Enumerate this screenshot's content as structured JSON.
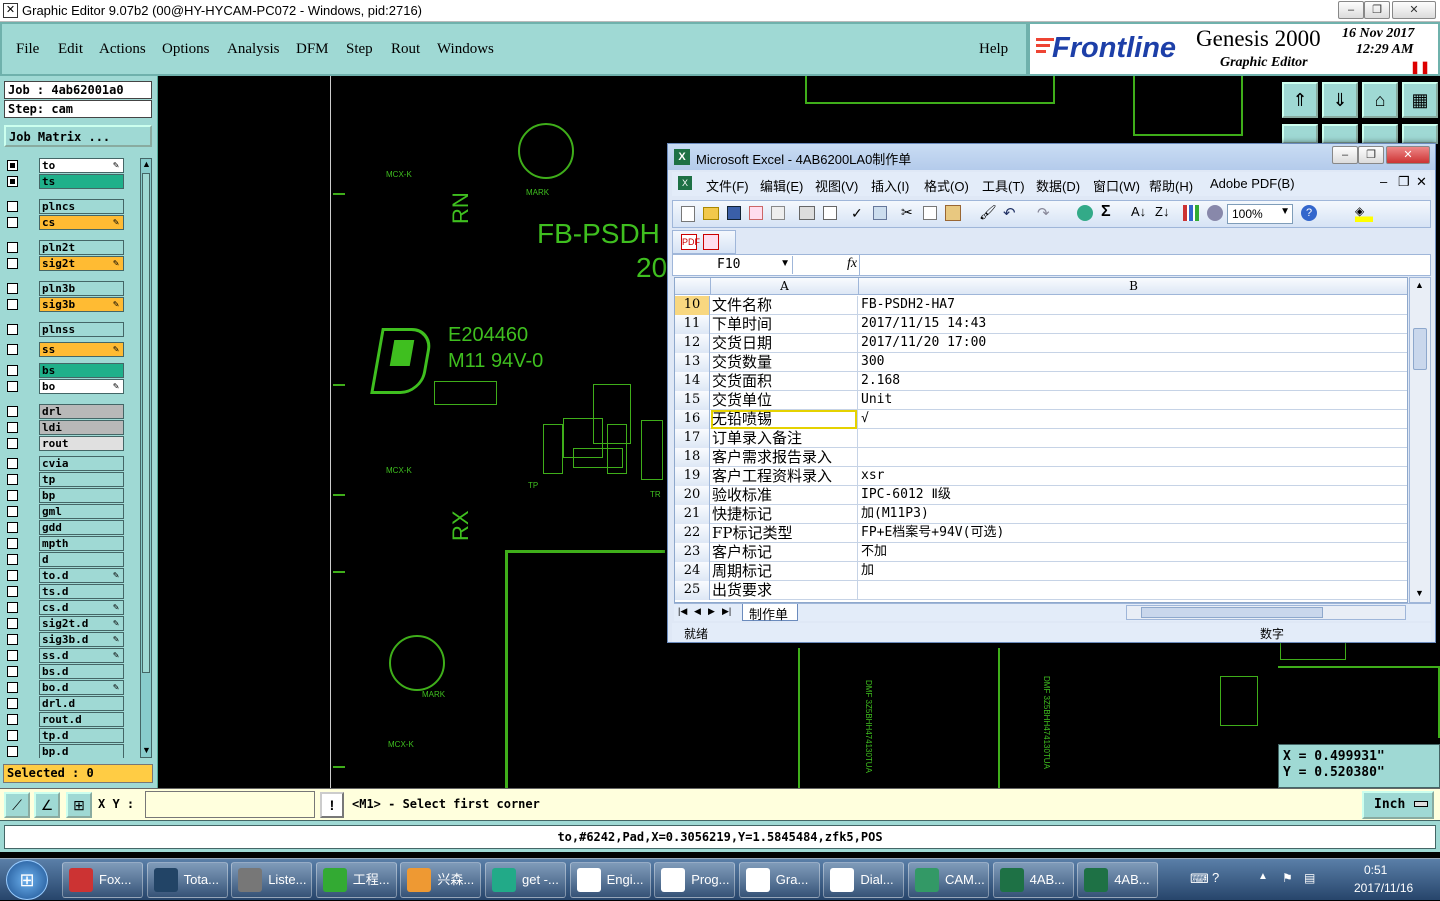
{
  "genesis": {
    "title": "Graphic Editor 9.07b2 (00@HY-HYCAM-PC072 - Windows, pid:2716)",
    "menu": [
      "File",
      "Edit",
      "Actions",
      "Options",
      "Analysis",
      "DFM",
      "Step",
      "Rout",
      "Windows"
    ],
    "help": "Help",
    "brand": "Frontline",
    "product": "Genesis 2000",
    "product_sub": "Graphic Editor",
    "date": "16 Nov 2017",
    "time": "12:29 AM",
    "job": "Job : 4ab62001a0",
    "step": "Step: cam",
    "job_matrix": "Job Matrix ...",
    "layers": [
      {
        "name": "to",
        "color": "#ffffff",
        "checked": true,
        "edit": true
      },
      {
        "name": "ts",
        "color": "#1fb08a",
        "checked": true,
        "edit": false
      },
      {
        "name": "plncs",
        "color": "#9fd9d4",
        "checked": false,
        "edit": false
      },
      {
        "name": "cs",
        "color": "#ffbb33",
        "checked": false,
        "edit": true
      },
      {
        "name": "pln2t",
        "color": "#9fd9d4",
        "checked": false,
        "edit": false
      },
      {
        "name": "sig2t",
        "color": "#ffbb33",
        "checked": false,
        "edit": true
      },
      {
        "name": "pln3b",
        "color": "#9fd9d4",
        "checked": false,
        "edit": false
      },
      {
        "name": "sig3b",
        "color": "#ffbb33",
        "checked": false,
        "edit": true
      },
      {
        "name": "plnss",
        "color": "#9fd9d4",
        "checked": false,
        "edit": false
      },
      {
        "name": "ss",
        "color": "#ffbb33",
        "checked": false,
        "edit": true
      },
      {
        "name": "bs",
        "color": "#1fb08a",
        "checked": false,
        "edit": false
      },
      {
        "name": "bo",
        "color": "#ffffff",
        "checked": false,
        "edit": true
      },
      {
        "name": "drl",
        "color": "#b8b8b8",
        "checked": false,
        "edit": false
      },
      {
        "name": "ldi",
        "color": "#b8b8b8",
        "checked": false,
        "edit": false
      },
      {
        "name": "rout",
        "color": "#e0e0e0",
        "checked": false,
        "edit": false
      },
      {
        "name": "cvia",
        "color": "#9fd9d4",
        "checked": false,
        "edit": false
      },
      {
        "name": "tp",
        "color": "#9fd9d4",
        "checked": false,
        "edit": false
      },
      {
        "name": "bp",
        "color": "#9fd9d4",
        "checked": false,
        "edit": false
      },
      {
        "name": "gml",
        "color": "#9fd9d4",
        "checked": false,
        "edit": false
      },
      {
        "name": "gdd",
        "color": "#9fd9d4",
        "checked": false,
        "edit": false
      },
      {
        "name": "mpth",
        "color": "#9fd9d4",
        "checked": false,
        "edit": false
      },
      {
        "name": "d",
        "color": "#9fd9d4",
        "checked": false,
        "edit": false
      },
      {
        "name": "to.d",
        "color": "#9fd9d4",
        "checked": false,
        "edit": true
      },
      {
        "name": "ts.d",
        "color": "#9fd9d4",
        "checked": false,
        "edit": false
      },
      {
        "name": "cs.d",
        "color": "#9fd9d4",
        "checked": false,
        "edit": true
      },
      {
        "name": "sig2t.d",
        "color": "#9fd9d4",
        "checked": false,
        "edit": true
      },
      {
        "name": "sig3b.d",
        "color": "#9fd9d4",
        "checked": false,
        "edit": true
      },
      {
        "name": "ss.d",
        "color": "#9fd9d4",
        "checked": false,
        "edit": true
      },
      {
        "name": "bs.d",
        "color": "#9fd9d4",
        "checked": false,
        "edit": false
      },
      {
        "name": "bo.d",
        "color": "#9fd9d4",
        "checked": false,
        "edit": true
      },
      {
        "name": "drl.d",
        "color": "#9fd9d4",
        "checked": false,
        "edit": false
      },
      {
        "name": "rout.d",
        "color": "#9fd9d4",
        "checked": false,
        "edit": false
      },
      {
        "name": "tp.d",
        "color": "#9fd9d4",
        "checked": false,
        "edit": false
      },
      {
        "name": "bp.d",
        "color": "#9fd9d4",
        "checked": false,
        "edit": false
      }
    ],
    "selected": "Selected : 0",
    "xy_label": "X Y :",
    "xy_value": "",
    "prompt": "<M1> - Select first corner",
    "units": "Inch",
    "status": "to,#6242,Pad,X=0.3056219,Y=1.5845484,zfk5,POS",
    "coord_x": "X = 0.499931\"",
    "coord_y": "Y = 0.520380\"",
    "canvas_text": {
      "fb": "FB-PSDH",
      "fb2": "20",
      "ul": "E204460",
      "ul2": "M11 94V-0",
      "rn": "RN",
      "rx": "RX",
      "mark": "MARK",
      "mcx": "MCX-K",
      "tp": "TP",
      "tr": "TR",
      "dmf1": "DMF 3Z5BHH474130TUA",
      "dmf2": "DMF 3Z5BHH474130TUA"
    }
  },
  "excel": {
    "title": "Microsoft Excel - 4AB6200LA0制作单",
    "menu": [
      "文件(F)",
      "编辑(E)",
      "视图(V)",
      "插入(I)",
      "格式(O)",
      "工具(T)",
      "数据(D)",
      "窗口(W)",
      "帮助(H)",
      "Adobe PDF(B)"
    ],
    "namebox": "F10",
    "zoom": "100%",
    "col_a": "A",
    "col_b": "B",
    "rows": [
      {
        "n": "10",
        "a": "文件名称",
        "b": "FB-PSDH2-HA7"
      },
      {
        "n": "11",
        "a": "下单时间",
        "b": "2017/11/15 14:43"
      },
      {
        "n": "12",
        "a": "交货日期",
        "b": "2017/11/20 17:00"
      },
      {
        "n": "13",
        "a": "交货数量",
        "b": "300"
      },
      {
        "n": "14",
        "a": "交货面积",
        "b": "2.168"
      },
      {
        "n": "15",
        "a": "交货单位",
        "b": "Unit"
      },
      {
        "n": "16",
        "a": "无铅喷锡",
        "b": "√"
      },
      {
        "n": "17",
        "a": "订单录入备注",
        "b": ""
      },
      {
        "n": "18",
        "a": "客户需求报告录入",
        "b": ""
      },
      {
        "n": "19",
        "a": "客户工程资料录入",
        "b": "xsr"
      },
      {
        "n": "20",
        "a": "验收标准",
        "b": "IPC-6012 Ⅱ级"
      },
      {
        "n": "21",
        "a": "快捷标记",
        "b": "加(M11P3)"
      },
      {
        "n": "22",
        "a": "FP标记类型",
        "b": "FP+E档案号+94V(可选)"
      },
      {
        "n": "23",
        "a": "客户标记",
        "b": "不加"
      },
      {
        "n": "24",
        "a": "周期标记",
        "b": "加"
      },
      {
        "n": "25",
        "a": "出货要求",
        "b": ""
      }
    ],
    "sheet_tab": "制作单",
    "status_left": "就绪",
    "status_num": "数字"
  },
  "taskbar": {
    "items": [
      "Fox...",
      "Tota...",
      "Liste...",
      "工程...",
      "兴森...",
      "get -...",
      "Engi...",
      "Prog...",
      "Gra...",
      "Dial...",
      "CAM...",
      "4AB...",
      "4AB..."
    ],
    "time": "0:51",
    "date": "2017/11/16"
  }
}
